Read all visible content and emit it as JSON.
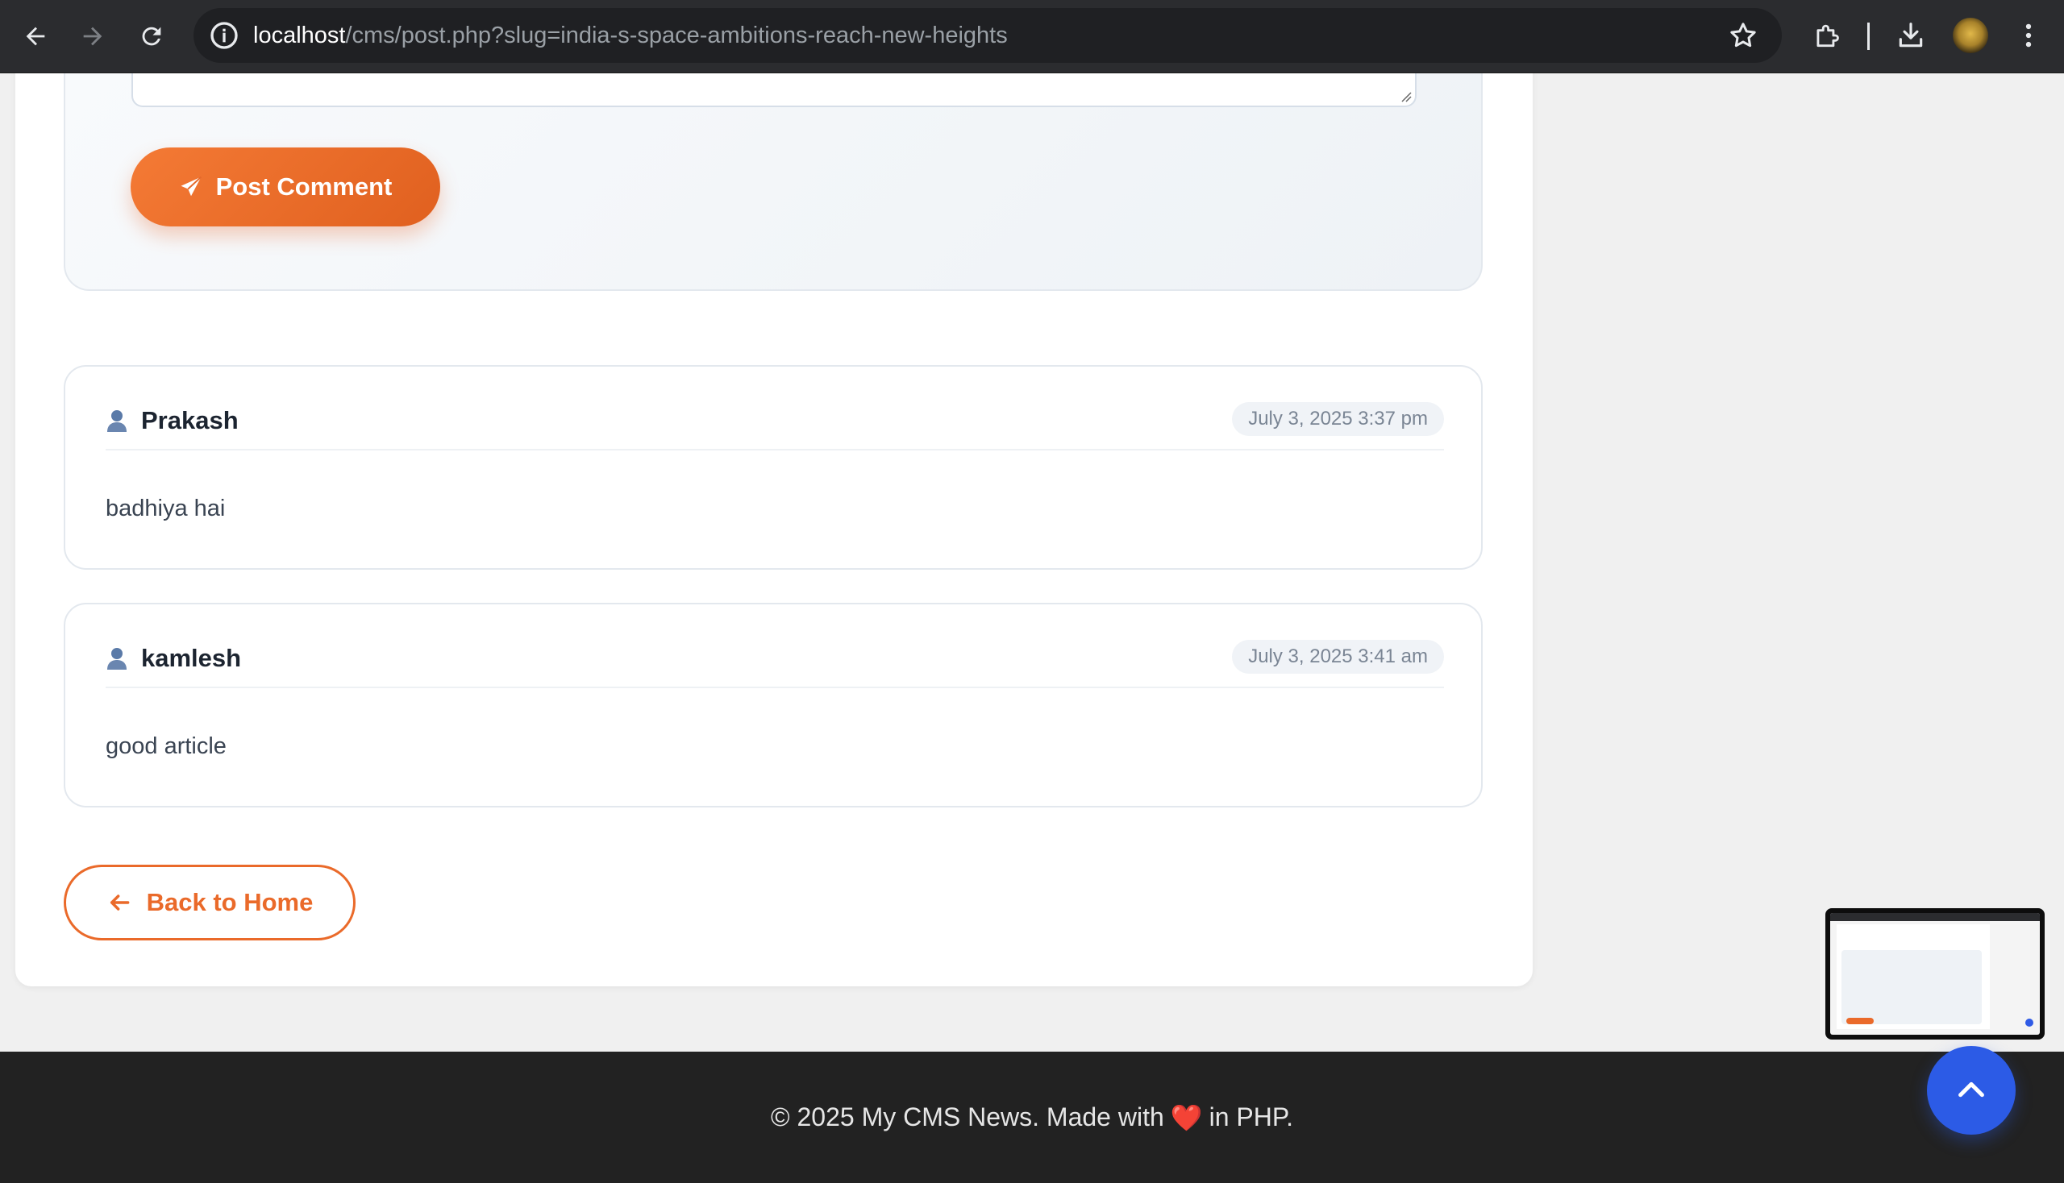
{
  "browser": {
    "url_host": "localhost",
    "url_path": "/cms/post.php?slug=india-s-space-ambitions-reach-new-heights"
  },
  "comment_form": {
    "submit_label": "Post Comment"
  },
  "comments": [
    {
      "author": "Prakash",
      "date": "July 3, 2025 3:37 pm",
      "text": "badhiya hai"
    },
    {
      "author": "kamlesh",
      "date": "July 3, 2025 3:41 am",
      "text": "good article"
    }
  ],
  "back_link": {
    "label": "Back to Home"
  },
  "footer": {
    "text_before": "© 2025 My CMS News. Made with",
    "heart": "❤️",
    "text_after": "in PHP."
  },
  "colors": {
    "accent": "#ea6a2a",
    "scroll_top": "#2c5be6",
    "footer_bg": "#222222"
  }
}
